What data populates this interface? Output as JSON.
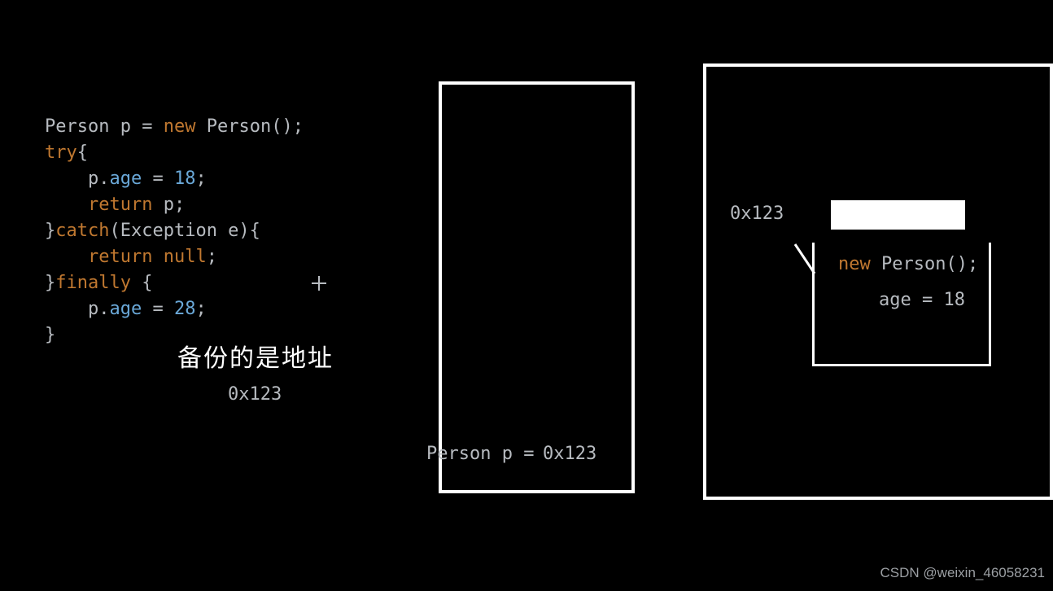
{
  "code": {
    "l1_type": "Person",
    "l1_var": " p ",
    "l1_eq": "= ",
    "l1_new": "new",
    "l1_call": " Person();",
    "l2_try": "try",
    "l2_brace": "{",
    "l3_indent": "    ",
    "l3_p": "p",
    "l3_dot": ".",
    "l3_field": "age",
    "l3_eq": " = ",
    "l3_val": "18",
    "l3_semi": ";",
    "l4_indent": "    ",
    "l4_ret": "return",
    "l4_rest": " p;",
    "l5_close": "}",
    "l5_catch": "catch",
    "l5_paren": "(Exception e){",
    "l6_indent": "    ",
    "l6_ret": "return",
    "l6_rest": " ",
    "l6_null": "null",
    "l6_semi": ";",
    "l7_close": "}",
    "l7_fin": "finally",
    "l7_brace": " {",
    "l8_indent": "    ",
    "l8_p": "p",
    "l8_dot": ".",
    "l8_field": "age",
    "l8_eq": " = ",
    "l8_val": "28",
    "l8_semi": ";",
    "l9_close": "}"
  },
  "annotations": {
    "chinese_note": "备份的是地址",
    "addr_below_note": "0x123"
  },
  "stack": {
    "label": "Person p =",
    "value": "0x123"
  },
  "heap": {
    "address": "0x123",
    "object_decl_new": "new",
    "object_decl_rest": " Person();",
    "field_line": "age = 18"
  },
  "watermark": "CSDN @weixin_46058231"
}
